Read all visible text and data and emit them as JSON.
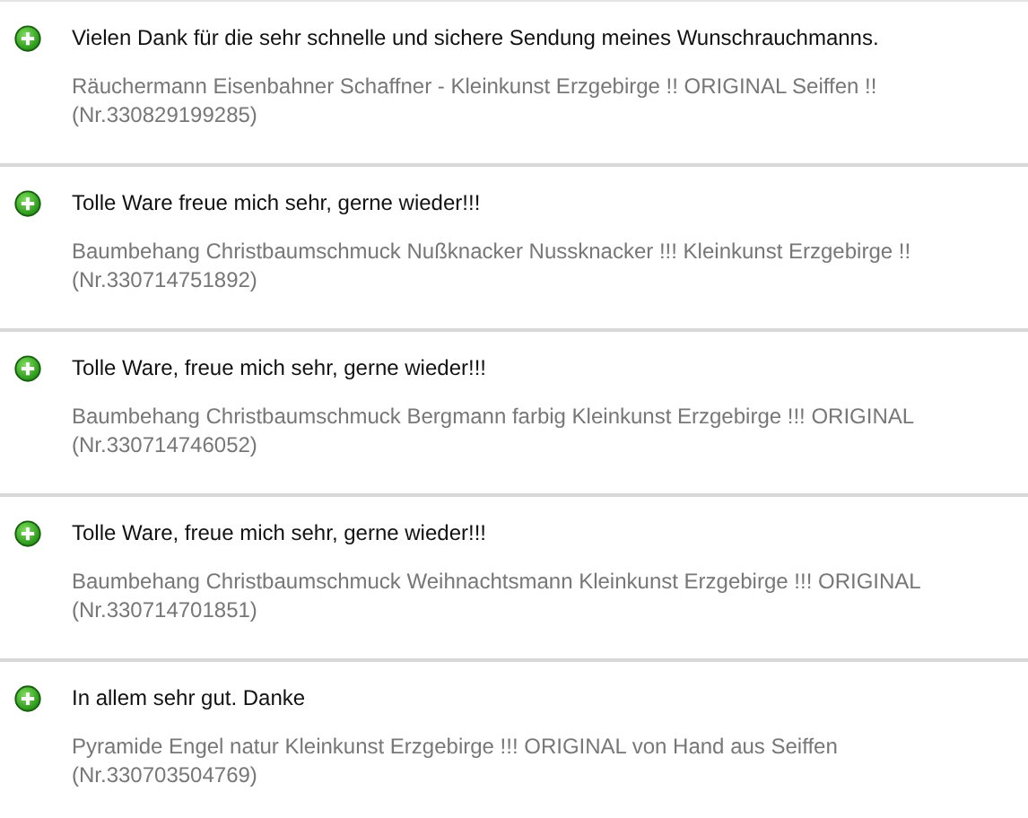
{
  "feedback": [
    {
      "kind": "positive",
      "comment": "Vielen Dank für die sehr schnelle und sichere Sendung meines Wunschrauchmanns.",
      "item": "Räuchermann Eisenbahner Schaffner - Kleinkunst Erzgebirge !! ORIGINAL Seiffen !!",
      "number": "(Nr.330829199285)"
    },
    {
      "kind": "positive",
      "comment": "Tolle Ware freue mich sehr, gerne wieder!!!",
      "item": "Baumbehang Christbaumschmuck Nußknacker Nussknacker !!! Kleinkunst Erzgebirge !!",
      "number": "(Nr.330714751892)"
    },
    {
      "kind": "positive",
      "comment": "Tolle Ware, freue mich sehr, gerne wieder!!!",
      "item": "Baumbehang Christbaumschmuck Bergmann farbig Kleinkunst Erzgebirge !!! ORIGINAL",
      "number": "(Nr.330714746052)"
    },
    {
      "kind": "positive",
      "comment": "Tolle Ware, freue mich sehr, gerne wieder!!!",
      "item": "Baumbehang Christbaumschmuck Weihnachtsmann Kleinkunst Erzgebirge !!! ORIGINAL",
      "number": "(Nr.330714701851)"
    },
    {
      "kind": "positive",
      "comment": "In allem sehr gut. Danke",
      "item": "Pyramide Engel natur Kleinkunst Erzgebirge !!! ORIGINAL von Hand aus Seiffen",
      "number": "(Nr.330703504769)"
    }
  ]
}
